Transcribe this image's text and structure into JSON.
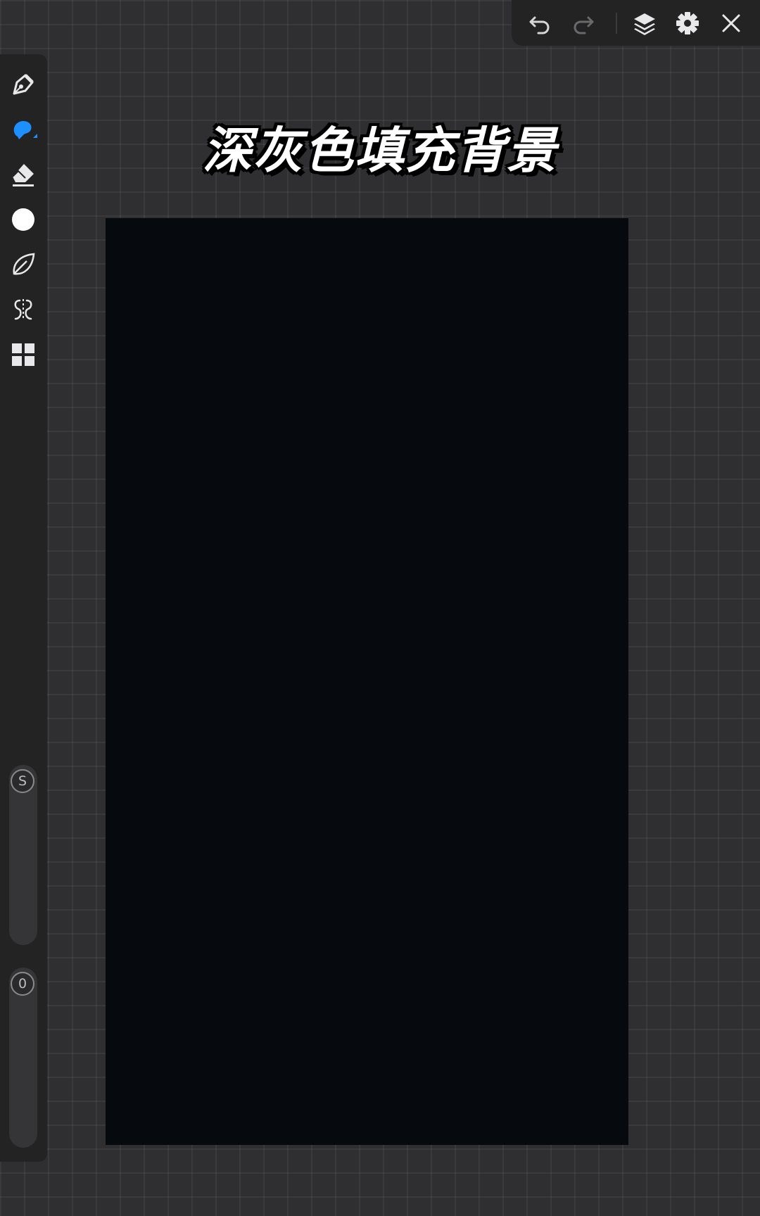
{
  "title": "深灰色填充背景",
  "sidebar": {
    "tools": [
      {
        "name": "paint-brush-tool",
        "icon": "pen-nib-icon",
        "active": false
      },
      {
        "name": "smudge-tool",
        "icon": "smudge-icon",
        "active": true
      },
      {
        "name": "eraser-tool",
        "icon": "eraser-icon",
        "active": false
      },
      {
        "name": "color-tool",
        "icon": "color-circle-icon",
        "active": false
      },
      {
        "name": "selection-tool",
        "icon": "lasso-leaf-icon",
        "active": false
      },
      {
        "name": "symmetry-tool",
        "icon": "symmetry-icon",
        "active": false
      },
      {
        "name": "gallery-tool",
        "icon": "grid-icon",
        "active": false
      }
    ],
    "size_label": "S",
    "opacity_label": "0"
  },
  "topbar": {
    "icons": [
      "undo-icon",
      "redo-icon",
      "layers-icon",
      "gear-icon",
      "close-icon"
    ]
  },
  "canvas": {
    "fill_color": "#06090d"
  },
  "colors": {
    "accent": "#1e8fff",
    "background": "#2f2f31",
    "panel": "#232324"
  }
}
